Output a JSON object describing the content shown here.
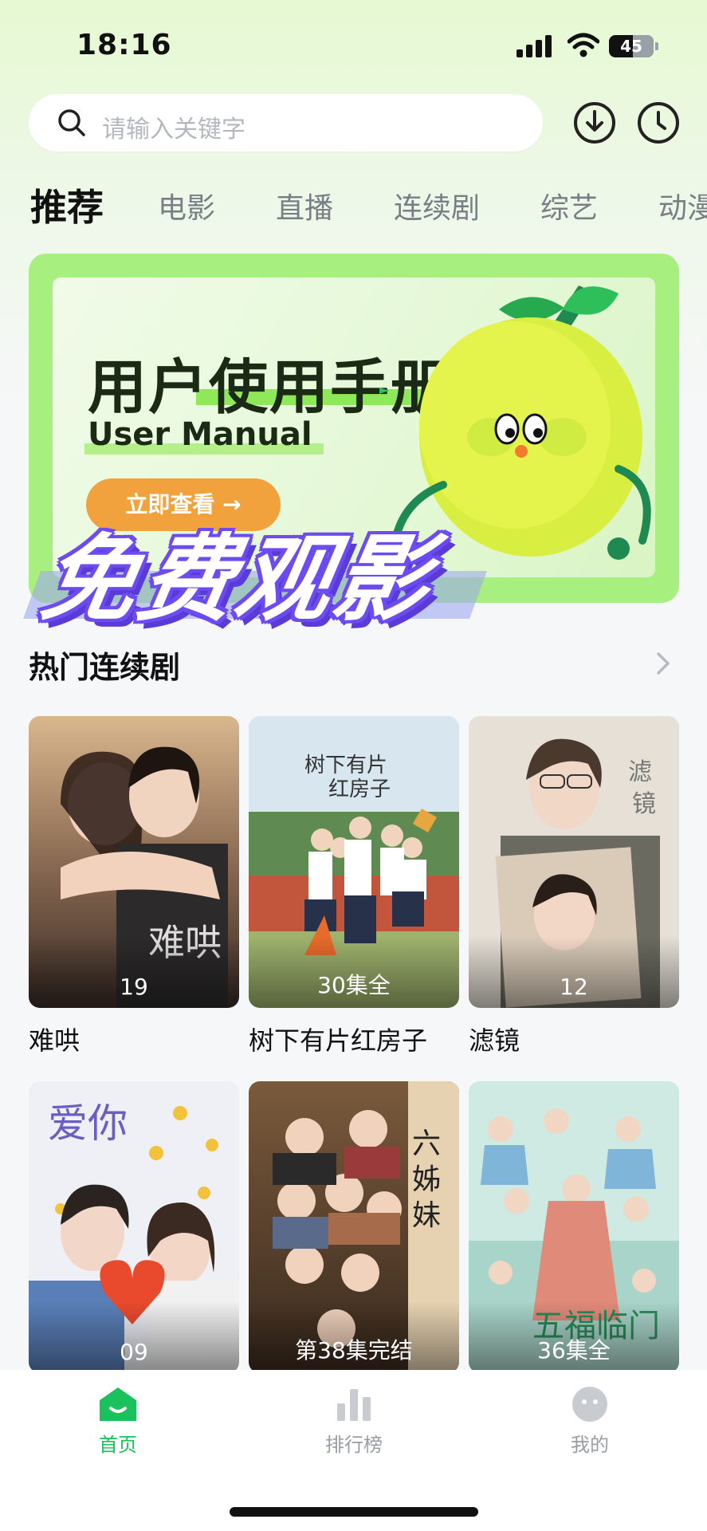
{
  "status": {
    "time": "18:16",
    "battery": "45"
  },
  "search": {
    "placeholder": "请输入关键字"
  },
  "header_icons": [
    "download-icon",
    "history-icon"
  ],
  "tabs": [
    {
      "label": "推荐",
      "active": true
    },
    {
      "label": "电影"
    },
    {
      "label": "直播"
    },
    {
      "label": "连续剧"
    },
    {
      "label": "综艺"
    },
    {
      "label": "动漫"
    }
  ],
  "banner": {
    "title": "用户使用手册",
    "subtitle": "User Manual",
    "button": "立即查看 →",
    "overlay": "免费观影",
    "accent": "#a7ef7e"
  },
  "section": {
    "title": "热门连续剧"
  },
  "dramas": [
    {
      "title": "难哄",
      "episodes": "19"
    },
    {
      "title": "树下有片红房子",
      "episodes": "30集全"
    },
    {
      "title": "滤镜",
      "episodes": "12"
    },
    {
      "title": "",
      "episodes": "09"
    },
    {
      "title": "",
      "episodes": "第38集完结"
    },
    {
      "title": "",
      "episodes": "36集全"
    }
  ],
  "nav": [
    {
      "label": "首页",
      "active": true,
      "icon": "home-icon"
    },
    {
      "label": "排行榜",
      "icon": "ranking-icon"
    },
    {
      "label": "我的",
      "icon": "profile-icon"
    }
  ],
  "colors": {
    "active_green": "#19c25a",
    "overlay_purple": "#6c4cf0"
  }
}
